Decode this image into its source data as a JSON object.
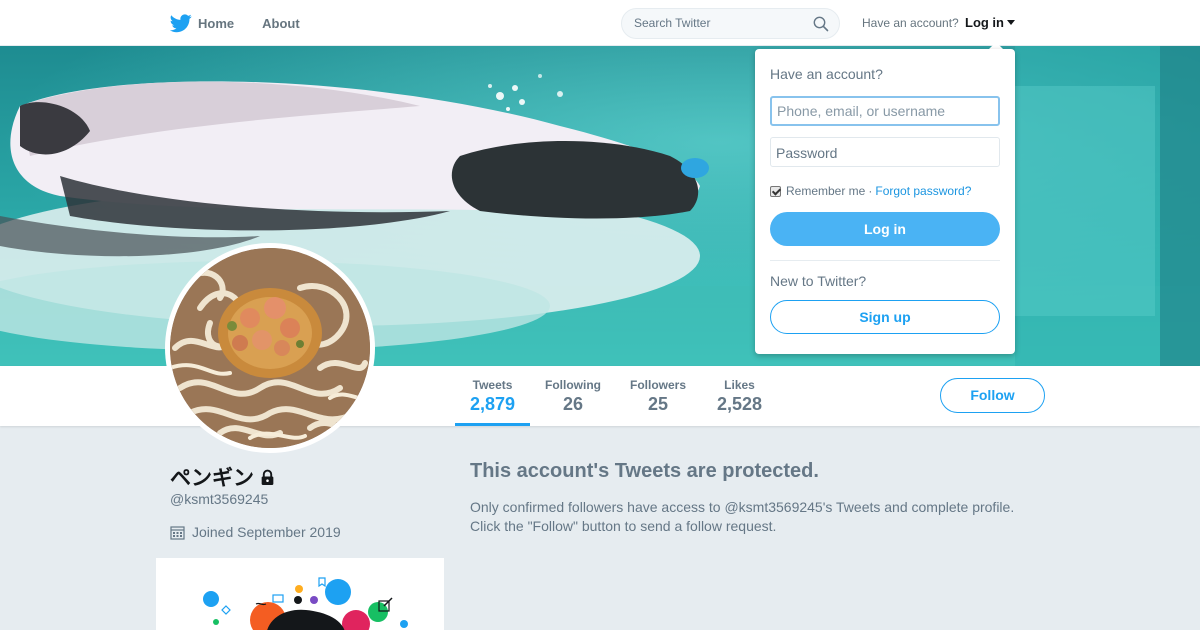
{
  "nav": {
    "home_label": "Home",
    "about_label": "About",
    "search_placeholder": "Search Twitter",
    "have_account": "Have an account?",
    "login_label": "Log in"
  },
  "profile": {
    "name": "ペンギン",
    "handle": "@ksmt3569245",
    "joined": "Joined September 2019"
  },
  "stats": [
    {
      "label": "Tweets",
      "value": "2,879"
    },
    {
      "label": "Following",
      "value": "26"
    },
    {
      "label": "Followers",
      "value": "25"
    },
    {
      "label": "Likes",
      "value": "2,528"
    }
  ],
  "follow_label": "Follow",
  "protected": {
    "title": "This account's Tweets are protected.",
    "line1": "Only confirmed followers have access to @ksmt3569245's Tweets and complete profile.",
    "line2": "Click the \"Follow\" button to send a follow request."
  },
  "login_dropdown": {
    "title": "Have an account?",
    "username_placeholder": "Phone, email, or username",
    "password_placeholder": "Password",
    "remember": "Remember me",
    "separator": "·",
    "forgot": "Forgot password?",
    "login_button": "Log in",
    "new_to_twitter": "New to Twitter?",
    "signup_button": "Sign up"
  },
  "colors": {
    "accent": "#1da1f2",
    "login_button": "#4ab3f4",
    "page_background": "#e6ecf0"
  }
}
